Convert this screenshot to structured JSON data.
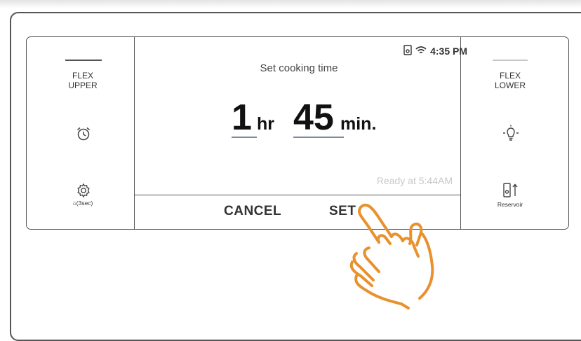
{
  "status_bar": {
    "time": "4:35 PM",
    "icons": [
      "door-lock-icon",
      "wifi-icon"
    ]
  },
  "left_panel": {
    "title": "FLEX\nUPPER",
    "timer_icon": "alarm-clock-icon",
    "settings_icon": "gear-icon",
    "settings_caption": "⌂(3sec)"
  },
  "right_panel": {
    "title": "FLEX\nLOWER",
    "light_icon": "light-bulb-icon",
    "reservoir_icon": "reservoir-icon",
    "reservoir_label": "Reservoir"
  },
  "main": {
    "prompt": "Set cooking time",
    "hours": "1",
    "hours_unit": "hr",
    "minutes": "45",
    "minutes_unit": "min.",
    "ready_text": "Ready at 5:44AM"
  },
  "buttons": {
    "cancel": "CANCEL",
    "set": "SET"
  },
  "colors": {
    "frame": "#555555",
    "accent_underline": "#7d8aa0",
    "hand": "#e8912e",
    "ready_text": "#c9c9c9"
  }
}
